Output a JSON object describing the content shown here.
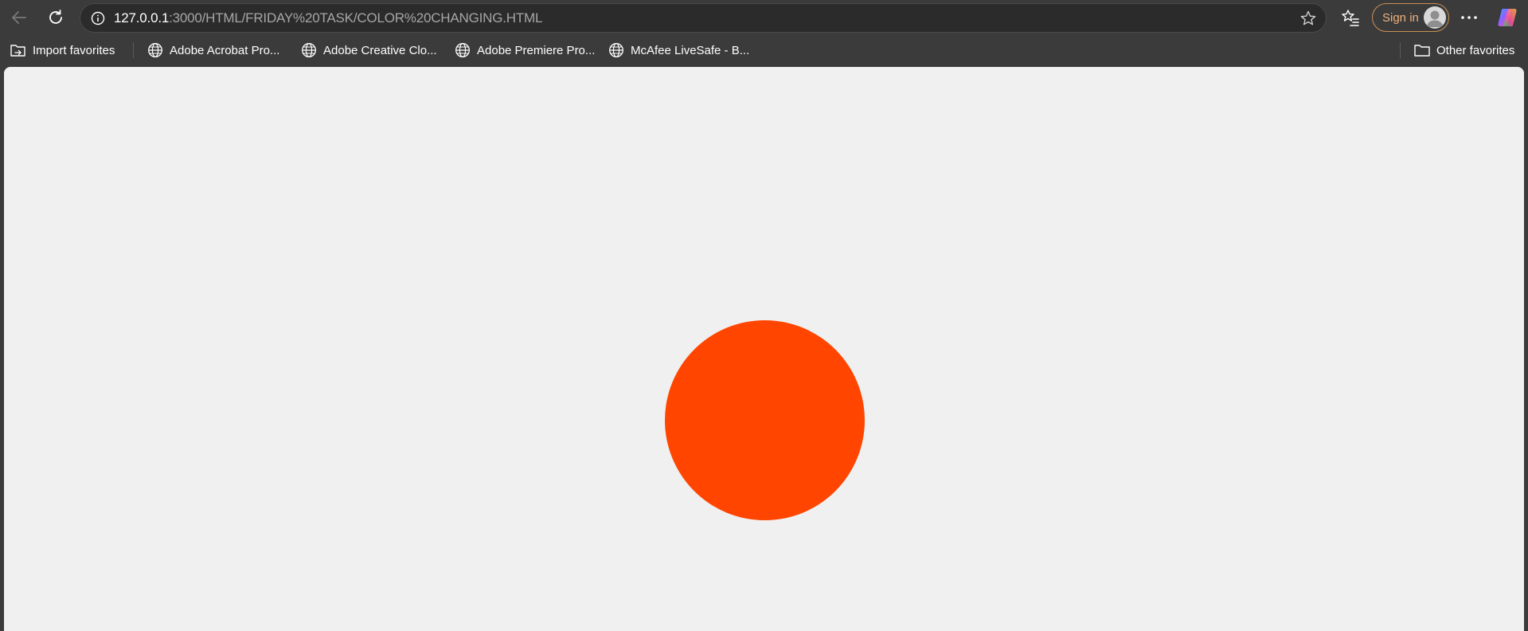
{
  "browser": {
    "url_host": "127.0.0.1",
    "url_path": ":3000/HTML/FRIDAY%20TASK/COLOR%20CHANGING.HTML",
    "signin_label": "Sign in"
  },
  "favorites": [
    {
      "label": "Import favorites",
      "icon": "import-favorites-icon"
    },
    {
      "label": "Adobe Acrobat Pro...",
      "icon": "globe-icon"
    },
    {
      "label": "Adobe Creative Clo...",
      "icon": "globe-icon"
    },
    {
      "label": "Adobe Premiere Pro...",
      "icon": "globe-icon"
    },
    {
      "label": "McAfee LiveSafe - B...",
      "icon": "globe-icon"
    }
  ],
  "other_favorites_label": "Other favorites",
  "page": {
    "background_color": "#f0f0f0",
    "circle_color": "#ff4500"
  }
}
